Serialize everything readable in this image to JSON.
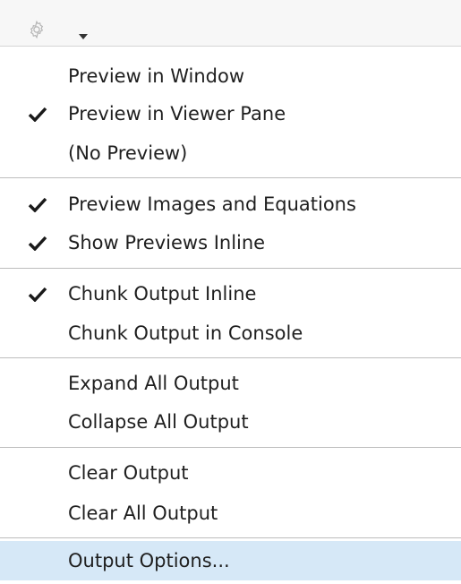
{
  "toolbar": {
    "gear_icon": "gear-icon",
    "caret_icon": "chevron-down-icon"
  },
  "menu": {
    "items": [
      {
        "label": "Preview in Window",
        "checked": false
      },
      {
        "label": "Preview in Viewer Pane",
        "checked": true
      },
      {
        "label": "(No Preview)",
        "checked": false
      },
      {
        "label": "Preview Images and Equations",
        "checked": true
      },
      {
        "label": "Show Previews Inline",
        "checked": true
      },
      {
        "label": "Chunk Output Inline",
        "checked": true
      },
      {
        "label": "Chunk Output in Console",
        "checked": false
      },
      {
        "label": "Expand All Output",
        "checked": false
      },
      {
        "label": "Collapse All Output",
        "checked": false
      },
      {
        "label": "Clear Output",
        "checked": false
      },
      {
        "label": "Clear All Output",
        "checked": false
      },
      {
        "label": "Output Options...",
        "checked": false,
        "selected": true
      }
    ]
  },
  "colors": {
    "selected_bg": "#d6e8f7",
    "check": "#1a1a1a",
    "separator": "#bdbdbd"
  }
}
